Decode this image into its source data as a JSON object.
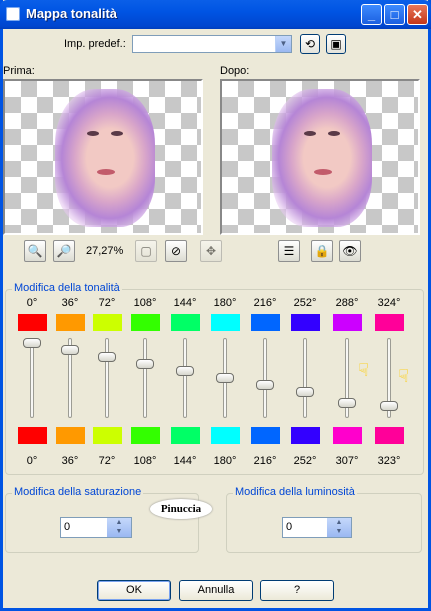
{
  "window": {
    "title": "Mappa tonalità",
    "controls": [
      "_",
      "□",
      "✕"
    ]
  },
  "preset": {
    "label": "Imp. predef.:",
    "value": "",
    "reset_icon": "reset-icon",
    "save_icon": "save-icon"
  },
  "preview": {
    "before_label": "Prima:",
    "after_label": "Dopo:"
  },
  "zoom": {
    "value": "27,27%",
    "zoom_out_icon": "zoom-out-icon",
    "zoom_in_icon": "zoom-in-icon"
  },
  "hue": {
    "legend": "Modifica della tonalità",
    "top_degrees": [
      "0°",
      "36°",
      "72°",
      "108°",
      "144°",
      "180°",
      "216°",
      "252°",
      "288°",
      "324°"
    ],
    "top_colors": [
      "#ff0000",
      "#ff9900",
      "#ccff00",
      "#33ff00",
      "#00ff66",
      "#00ffff",
      "#0066ff",
      "#3300ff",
      "#cc00ff",
      "#ff0099"
    ],
    "bottom_degrees": [
      "0°",
      "36°",
      "72°",
      "108°",
      "144°",
      "180°",
      "216°",
      "252°",
      "307°",
      "323°"
    ],
    "bottom_colors": [
      "#ff0000",
      "#ff9900",
      "#ccff00",
      "#33ff00",
      "#00ff66",
      "#00ffff",
      "#0066ff",
      "#3300ff",
      "#ff00cc",
      "#ff0099"
    ],
    "slider_levels": [
      0.0,
      0.1,
      0.2,
      0.3,
      0.4,
      0.5,
      0.6,
      0.7,
      0.85,
      0.9
    ]
  },
  "saturation": {
    "legend": "Modifica della saturazione",
    "value": "0"
  },
  "luminosity": {
    "legend": "Modifica della luminosità",
    "value": "0"
  },
  "watermark": "Pinuccia",
  "buttons": {
    "ok": "OK",
    "cancel": "Annulla",
    "help": "?"
  }
}
